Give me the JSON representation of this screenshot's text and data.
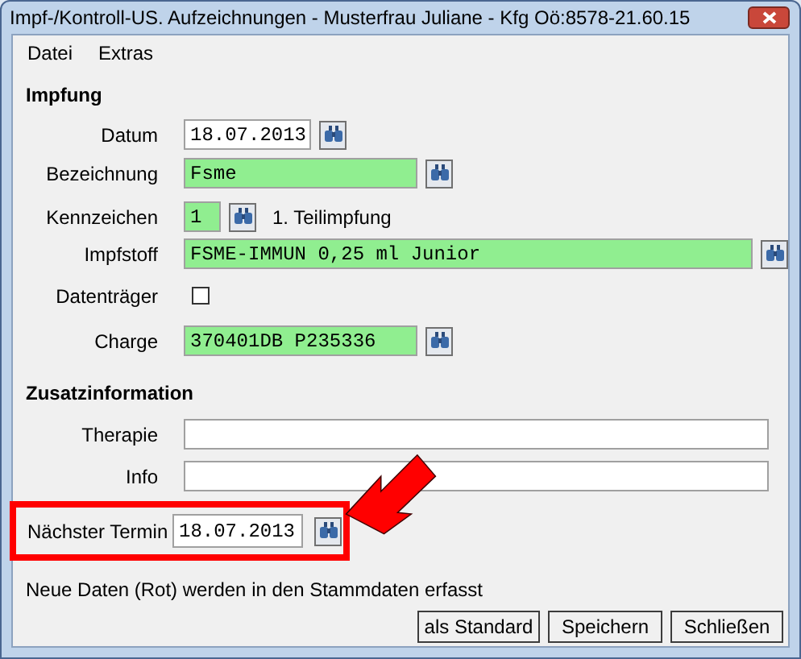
{
  "window": {
    "title": "Impf-/Kontroll-US. Aufzeichnungen - Musterfrau Juliane - Kfg Oö:8578-21.60.15"
  },
  "menu": [
    "Datei",
    "Extras"
  ],
  "impfung": {
    "heading": "Impfung",
    "fields": [
      {
        "kind": "text",
        "label": "Datum",
        "value": "18.07.2013",
        "highlighted": false,
        "lookup_button": true
      },
      {
        "kind": "text",
        "label": "Bezeichnung",
        "value": "Fsme",
        "highlighted": true,
        "lookup_button": true
      },
      {
        "kind": "text",
        "label": "Kennzeichen",
        "value": "1",
        "highlighted": true,
        "lookup_button": true,
        "note": "1. Teilimpfung"
      },
      {
        "kind": "text",
        "label": "Impfstoff",
        "value": "FSME-IMMUN 0,25 ml Junior",
        "highlighted": true,
        "lookup_button": true
      },
      {
        "kind": "checkbox",
        "label": "Datenträger",
        "checked": false
      },
      {
        "kind": "text",
        "label": "Charge",
        "value": "370401DB P235336",
        "highlighted": true,
        "lookup_button": true
      }
    ]
  },
  "zusatzinformation": {
    "heading": "Zusatzinformation",
    "fields": [
      {
        "kind": "text",
        "label": "Therapie",
        "highlighted": false,
        "lookup_button": false
      },
      {
        "kind": "text",
        "label": "Info",
        "highlighted": false,
        "lookup_button": false
      }
    ]
  },
  "next_appointment": {
    "label": "Nächster Termin",
    "value": "18.07.2013",
    "lookup_button": true,
    "marked": true
  },
  "status_text": "Neue Daten (Rot) werden in den Stammdaten erfasst",
  "buttons": [
    "als Standard",
    "Speichern",
    "Schließen"
  ]
}
